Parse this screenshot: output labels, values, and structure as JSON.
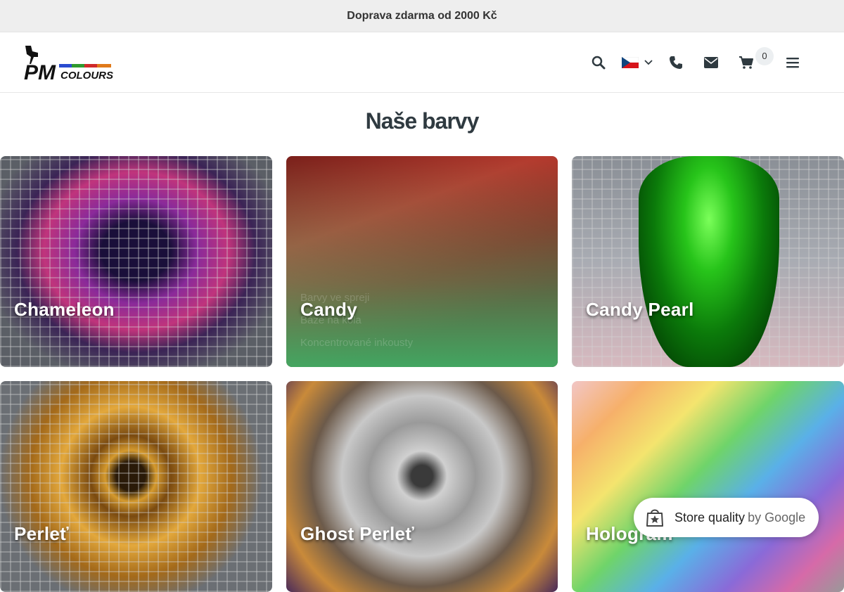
{
  "topbar": {
    "text": "Doprava zdarma od 2000 Kč"
  },
  "header": {
    "logo_text": "PMcolours",
    "cart_count": "0"
  },
  "colors": {
    "brand_dark": "#2f3a40",
    "topbar_bg": "#eeeeee",
    "accent_green": "#3cbe6e"
  },
  "section": {
    "title": "Naše barvy"
  },
  "cards": [
    {
      "label": "Chameleon"
    },
    {
      "label": "Candy",
      "sublinks": [
        "Barvy ve spreji",
        "Báze na kola",
        "Koncentrované inkousty"
      ]
    },
    {
      "label": "Candy Pearl"
    },
    {
      "label": "Perleť"
    },
    {
      "label": "Ghost Perleť"
    },
    {
      "label": "Hologram"
    }
  ],
  "store_quality": {
    "label": "Store quality",
    "by": "by Google"
  }
}
